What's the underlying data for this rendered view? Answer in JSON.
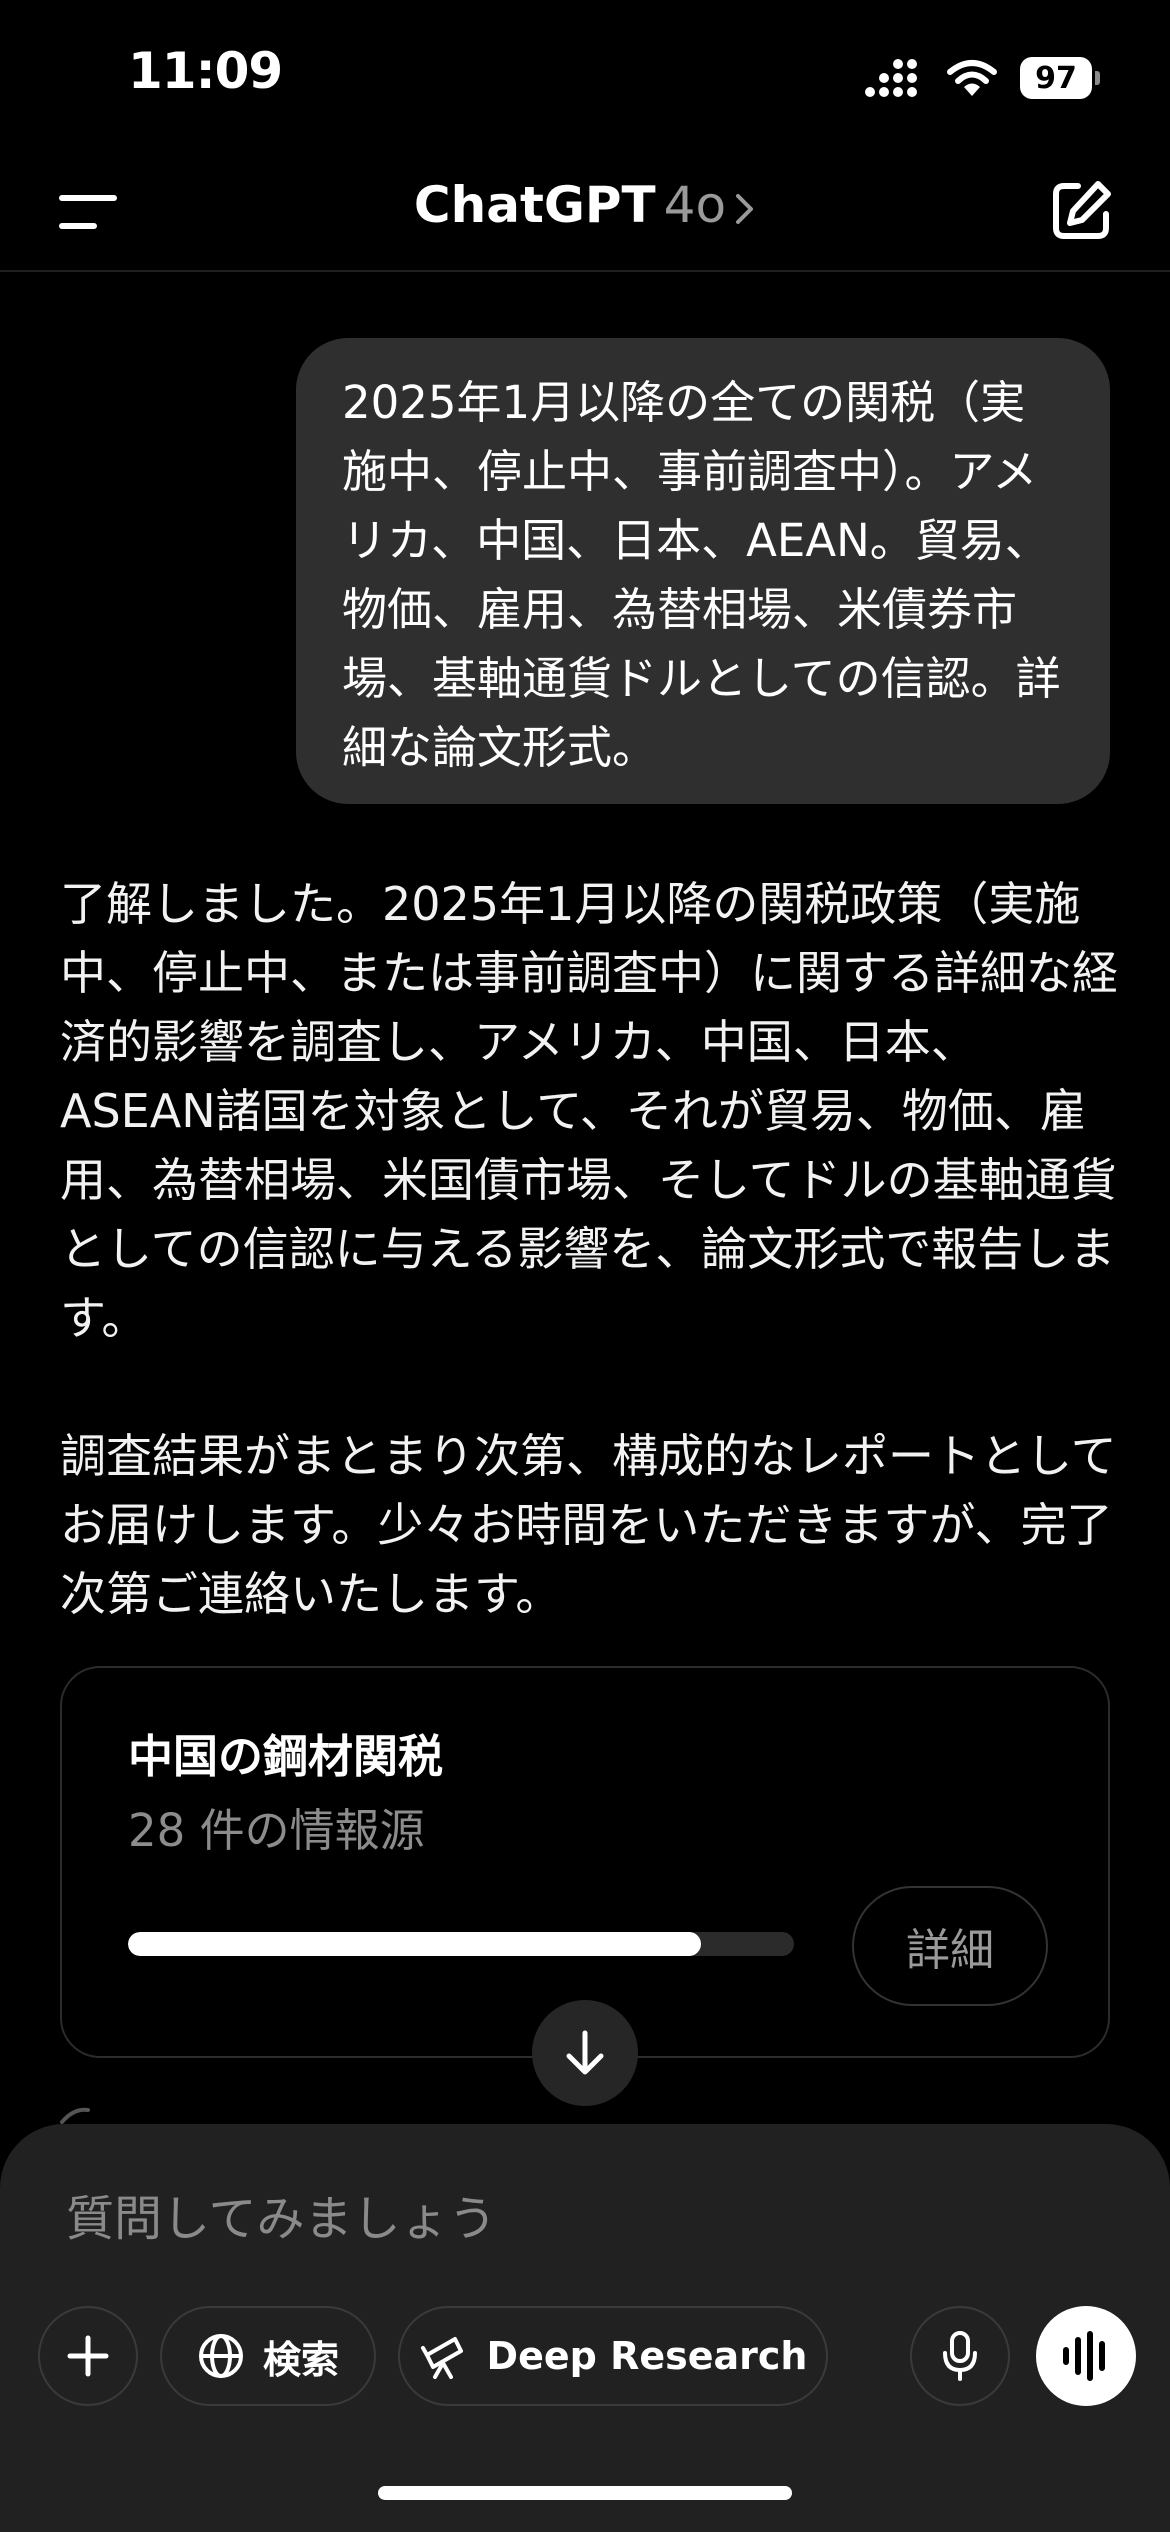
{
  "status_bar": {
    "time": "11:09",
    "battery": "97"
  },
  "header": {
    "title": "ChatGPT",
    "model": "4o"
  },
  "conversation": {
    "user_message": "2025年1月以降の全ての関税（実施中、停止中、事前調査中）。アメリカ、中国、日本、AEAN。貿易、物価、雇用、為替相場、米債券市場、基軸通貨ドルとしての信認。詳細な論文形式。",
    "assistant_paragraphs": [
      "了解しました。2025年1月以降の関税政策（実施中、停止中、または事前調査中）に関する詳細な経済的影響を調査し、アメリカ、中国、日本、ASEAN諸国を対象として、それが貿易、物価、雇用、為替相場、米国債市場、そしてドルの基軸通貨としての信認に与える影響を、論文形式で報告します。",
      "調査結果がまとまり次第、構成的なレポートとしてお届けします。少々お時間をいただきますが、完了次第ご連絡いたします。"
    ]
  },
  "research_card": {
    "title": "中国の鋼材関税",
    "sources": "28 件の情報源",
    "progress": 0.86,
    "details_label": "詳細"
  },
  "composer": {
    "placeholder": "質問してみましょう",
    "search_label": "検索",
    "deep_research_label": "Deep Research"
  }
}
